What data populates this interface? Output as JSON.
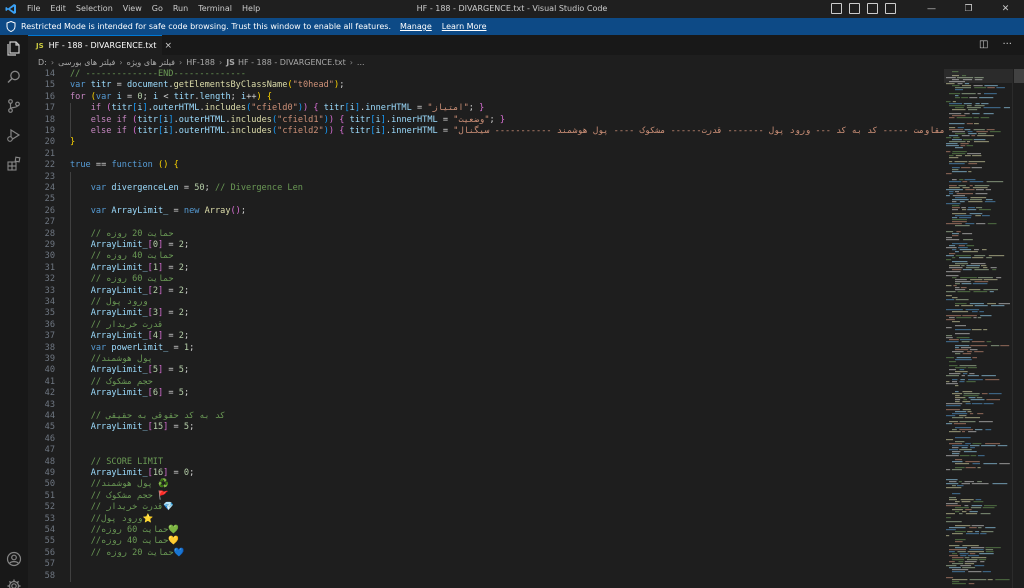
{
  "window": {
    "title": "HF - 188 - DIVARGENCE.txt - Visual Studio Code",
    "menu": [
      "File",
      "Edit",
      "Selection",
      "View",
      "Go",
      "Run",
      "Terminal",
      "Help"
    ]
  },
  "banner": {
    "message": "Restricted Mode is intended for safe code browsing. Trust this window to enable all features.",
    "manage": "Manage",
    "learn_more": "Learn More"
  },
  "tab": {
    "badge": "JS",
    "label": "HF - 188 - DIVARGENCE.txt",
    "close": "×"
  },
  "breadcrumb": {
    "drive": "D:",
    "folder1": "فیلتر های بورسی",
    "folder2": "فیلتر های ویژه",
    "folder3": "HF-188",
    "badge": "JS",
    "file": "HF - 188 - DIVARGENCE.txt",
    "more": "..."
  },
  "code_lines": [
    {
      "n": "14",
      "html": "<span class='c'>// --------------END--------------</span>"
    },
    {
      "n": "15",
      "html": "<span class='k'>var</span> <span class='v'>titr</span> <span class='p'>=</span> <span class='v'>document</span><span class='p'>.</span><span class='f'>getElementsByClassName</span><span class='br1'>(</span><span class='s'>\"t0head\"</span><span class='br1'>)</span><span class='p'>;</span>"
    },
    {
      "n": "16",
      "html": "<span class='kc'>for</span> <span class='br1'>(</span><span class='k'>var</span> <span class='v'>i</span> <span class='p'>=</span> <span class='n'>0</span><span class='p'>;</span> <span class='v'>i</span> <span class='p'>&lt;</span> <span class='v'>titr</span><span class='p'>.</span><span class='v'>length</span><span class='p'>;</span> <span class='v'>i</span><span class='p'>++</span><span class='br1'>)</span> <span class='br1'>{</span>"
    },
    {
      "n": "17",
      "html": "    <span class='kc'>if</span> <span class='br2'>(</span><span class='v'>titr</span><span class='br3'>[</span><span class='v'>i</span><span class='br3'>]</span><span class='p'>.</span><span class='v'>outerHTML</span><span class='p'>.</span><span class='f'>includes</span><span class='br3'>(</span><span class='s'>\"cfield0\"</span><span class='br3'>)</span><span class='br2'>)</span> <span class='br2'>{</span> <span class='v'>titr</span><span class='br3'>[</span><span class='v'>i</span><span class='br3'>]</span><span class='p'>.</span><span class='v'>innerHTML</span> <span class='p'>=</span> <span class='s'>\"امتیاز\"</span><span class='p'>;</span> <span class='br2'>}</span>"
    },
    {
      "n": "18",
      "html": "    <span class='kc'>else</span> <span class='kc'>if</span> <span class='br2'>(</span><span class='v'>titr</span><span class='br3'>[</span><span class='v'>i</span><span class='br3'>]</span><span class='p'>.</span><span class='v'>outerHTML</span><span class='p'>.</span><span class='f'>includes</span><span class='br3'>(</span><span class='s'>\"cfield1\"</span><span class='br3'>)</span><span class='br2'>)</span> <span class='br2'>{</span> <span class='v'>titr</span><span class='br3'>[</span><span class='v'>i</span><span class='br3'>]</span><span class='p'>.</span><span class='v'>innerHTML</span> <span class='p'>=</span> <span class='s'>\"وضعیت\"</span><span class='p'>;</span> <span class='br2'>}</span>"
    },
    {
      "n": "19",
      "html": "    <span class='kc'>else</span> <span class='kc'>if</span> <span class='br2'>(</span><span class='v'>titr</span><span class='br3'>[</span><span class='v'>i</span><span class='br3'>]</span><span class='p'>.</span><span class='v'>outerHTML</span><span class='p'>.</span><span class='f'>includes</span><span class='br3'>(</span><span class='s'>\"cfield2\"</span><span class='br3'>)</span><span class='br2'>)</span> <span class='br2'>{</span> <span class='v'>titr</span><span class='br3'>[</span><span class='v'>i</span><span class='br3'>]</span><span class='p'>.</span><span class='v'>innerHTML</span> <span class='p'>=</span> <span class='s'>\"حمایت و مقاومت ----- کد به کد --- ورود پول ------- قدرت------ مشکوک ---- پول هوشمند ----------- سیگنال\"</span><span class='p'>;</span>"
    },
    {
      "n": "20",
      "html": "<span class='br1'>}</span>"
    },
    {
      "n": "21",
      "html": ""
    },
    {
      "n": "22",
      "html": "<span class='k'>true</span> <span class='p'>==</span> <span class='k'>function</span> <span class='br1'>()</span> <span class='br1'>{</span>"
    },
    {
      "n": "23",
      "html": ""
    },
    {
      "n": "24",
      "html": "    <span class='k'>var</span> <span class='v'>divergenceLen</span> <span class='p'>=</span> <span class='n'>50</span><span class='p'>;</span> <span class='c'>// Divergence Len</span>"
    },
    {
      "n": "25",
      "html": ""
    },
    {
      "n": "26",
      "html": "    <span class='k'>var</span> <span class='v'>ArrayLimit_</span> <span class='p'>=</span> <span class='k'>new</span> <span class='f'>Array</span><span class='br2'>()</span><span class='p'>;</span>"
    },
    {
      "n": "27",
      "html": ""
    },
    {
      "n": "28",
      "html": "    <span class='c'>// حمایت 20 روزه</span>"
    },
    {
      "n": "29",
      "html": "    <span class='v'>ArrayLimit_</span><span class='br2'>[</span><span class='n'>0</span><span class='br2'>]</span> <span class='p'>=</span> <span class='n'>2</span><span class='p'>;</span>"
    },
    {
      "n": "30",
      "html": "    <span class='c'>// حمایت 40 روزه</span>"
    },
    {
      "n": "31",
      "html": "    <span class='v'>ArrayLimit_</span><span class='br2'>[</span><span class='n'>1</span><span class='br2'>]</span> <span class='p'>=</span> <span class='n'>2</span><span class='p'>;</span>"
    },
    {
      "n": "32",
      "html": "    <span class='c'>// حمایت 60 روزه</span>"
    },
    {
      "n": "33",
      "html": "    <span class='v'>ArrayLimit_</span><span class='br2'>[</span><span class='n'>2</span><span class='br2'>]</span> <span class='p'>=</span> <span class='n'>2</span><span class='p'>;</span>"
    },
    {
      "n": "34",
      "html": "    <span class='c'>// ورود پول</span>"
    },
    {
      "n": "35",
      "html": "    <span class='v'>ArrayLimit_</span><span class='br2'>[</span><span class='n'>3</span><span class='br2'>]</span> <span class='p'>=</span> <span class='n'>2</span><span class='p'>;</span>"
    },
    {
      "n": "36",
      "html": "    <span class='c'>// قدرت خریدار</span>"
    },
    {
      "n": "37",
      "html": "    <span class='v'>ArrayLimit_</span><span class='br2'>[</span><span class='n'>4</span><span class='br2'>]</span> <span class='p'>=</span> <span class='n'>2</span><span class='p'>;</span>"
    },
    {
      "n": "38",
      "html": "    <span class='k'>var</span> <span class='v'>powerLimit_</span> <span class='p'>=</span> <span class='n'>1</span><span class='p'>;</span>"
    },
    {
      "n": "39",
      "html": "    <span class='c'>//پول هوشمند</span>"
    },
    {
      "n": "40",
      "html": "    <span class='v'>ArrayLimit_</span><span class='br2'>[</span><span class='n'>5</span><span class='br2'>]</span> <span class='p'>=</span> <span class='n'>5</span><span class='p'>;</span>"
    },
    {
      "n": "41",
      "html": "    <span class='c'>// حجم مشکوک</span>"
    },
    {
      "n": "42",
      "html": "    <span class='v'>ArrayLimit_</span><span class='br2'>[</span><span class='n'>6</span><span class='br2'>]</span> <span class='p'>=</span> <span class='n'>5</span><span class='p'>;</span>"
    },
    {
      "n": "43",
      "html": ""
    },
    {
      "n": "44",
      "html": "    <span class='c'>// کد به کد حقوقی به حقیقی</span>"
    },
    {
      "n": "45",
      "html": "    <span class='v'>ArrayLimit_</span><span class='br2'>[</span><span class='n'>15</span><span class='br2'>]</span> <span class='p'>=</span> <span class='n'>5</span><span class='p'>;</span>"
    },
    {
      "n": "46",
      "html": ""
    },
    {
      "n": "47",
      "html": ""
    },
    {
      "n": "48",
      "html": "    <span class='c'>// SCORE LIMIT</span>"
    },
    {
      "n": "49",
      "html": "    <span class='v'>ArrayLimit_</span><span class='br2'>[</span><span class='n'>16</span><span class='br2'>]</span> <span class='p'>=</span> <span class='n'>0</span><span class='p'>;</span>"
    },
    {
      "n": "50",
      "html": "    <span class='c'>//پول هوشمند ♻️</span>"
    },
    {
      "n": "51",
      "html": "    <span class='c'>// حجم مشکوک 🚩</span>"
    },
    {
      "n": "52",
      "html": "    <span class='c'>// قدرت خریدار💎</span>"
    },
    {
      "n": "53",
      "html": "    <span class='c'>//ورود پول⭐</span>"
    },
    {
      "n": "54",
      "html": "    <span class='c'>//حمایت 60 روزه💚</span>"
    },
    {
      "n": "55",
      "html": "    <span class='c'>//حمایت 40 روزه💛</span>"
    },
    {
      "n": "56",
      "html": "    <span class='c'>// حمایت 20 روزه💙</span>"
    },
    {
      "n": "57",
      "html": ""
    },
    {
      "n": "58",
      "html": ""
    }
  ],
  "colors": {
    "accent": "#0078d4",
    "banner": "#0d4a86",
    "editor_bg": "#1e1e1e"
  }
}
